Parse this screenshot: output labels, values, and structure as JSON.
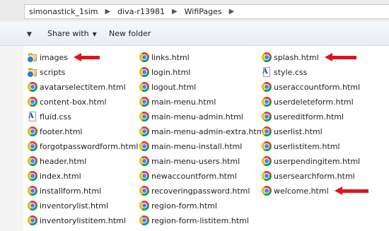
{
  "breadcrumb": [
    "simonastick_1sim",
    "diva-r13981",
    "WifiPages"
  ],
  "toolbar": {
    "share_label": "Share with",
    "new_folder_label": "New folder"
  },
  "columns": [
    [
      {
        "name": "images",
        "icon": "folder"
      },
      {
        "name": "scripts",
        "icon": "folder"
      },
      {
        "name": "avatarselectitem.html",
        "icon": "chrome"
      },
      {
        "name": "content-box.html",
        "icon": "chrome"
      },
      {
        "name": "fluid.css",
        "icon": "css"
      },
      {
        "name": "footer.html",
        "icon": "chrome"
      },
      {
        "name": "forgotpasswordform.html",
        "icon": "chrome"
      },
      {
        "name": "header.html",
        "icon": "chrome"
      },
      {
        "name": "index.html",
        "icon": "chrome"
      },
      {
        "name": "installform.html",
        "icon": "chrome"
      },
      {
        "name": "inventorylist.html",
        "icon": "chrome"
      },
      {
        "name": "inventorylistitem.html",
        "icon": "chrome"
      }
    ],
    [
      {
        "name": "links.html",
        "icon": "chrome"
      },
      {
        "name": "login.html",
        "icon": "chrome"
      },
      {
        "name": "logout.html",
        "icon": "chrome"
      },
      {
        "name": "main-menu.html",
        "icon": "chrome"
      },
      {
        "name": "main-menu-admin.html",
        "icon": "chrome"
      },
      {
        "name": "main-menu-admin-extra.html",
        "icon": "chrome"
      },
      {
        "name": "main-menu-install.html",
        "icon": "chrome"
      },
      {
        "name": "main-menu-users.html",
        "icon": "chrome"
      },
      {
        "name": "newaccountform.html",
        "icon": "chrome"
      },
      {
        "name": "recoveringpassword.html",
        "icon": "chrome"
      },
      {
        "name": "region-form.html",
        "icon": "chrome"
      },
      {
        "name": "region-form-listitem.html",
        "icon": "chrome"
      }
    ],
    [
      {
        "name": "splash.html",
        "icon": "chrome"
      },
      {
        "name": "style.css",
        "icon": "css"
      },
      {
        "name": "useraccountform.html",
        "icon": "chrome"
      },
      {
        "name": "userdeleteform.html",
        "icon": "chrome"
      },
      {
        "name": "usereditform.html",
        "icon": "chrome"
      },
      {
        "name": "userlist.html",
        "icon": "chrome"
      },
      {
        "name": "userlistitem.html",
        "icon": "chrome"
      },
      {
        "name": "userpendingitem.html",
        "icon": "chrome"
      },
      {
        "name": "usersearchform.html",
        "icon": "chrome"
      },
      {
        "name": "welcome.html",
        "icon": "chrome"
      }
    ]
  ],
  "highlight_color": "#e0141b",
  "highlighted_items": [
    "images",
    "splash.html",
    "welcome.html"
  ]
}
